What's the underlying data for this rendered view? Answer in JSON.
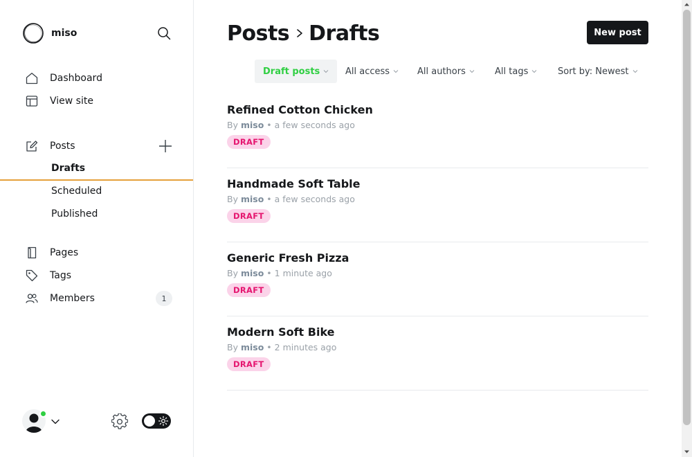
{
  "brand": {
    "name": "miso"
  },
  "sidebar": {
    "items": [
      {
        "label": "Dashboard",
        "icon": "home-icon"
      },
      {
        "label": "View site",
        "icon": "layout-icon"
      },
      {
        "label": "Posts",
        "icon": "edit-icon"
      },
      {
        "label": "Pages",
        "icon": "page-icon"
      },
      {
        "label": "Tags",
        "icon": "tag-icon"
      },
      {
        "label": "Members",
        "icon": "members-icon",
        "count": "1"
      }
    ],
    "post_subitems": [
      {
        "label": "Drafts",
        "active": true
      },
      {
        "label": "Scheduled"
      },
      {
        "label": "Published"
      }
    ],
    "accent_color": "#e5a03a"
  },
  "header": {
    "breadcrumb_parent": "Posts",
    "breadcrumb_current": "Drafts",
    "new_post_label": "New post"
  },
  "filters": [
    {
      "label": "Draft posts",
      "active": true
    },
    {
      "label": "All access"
    },
    {
      "label": "All authors"
    },
    {
      "label": "All tags"
    },
    {
      "label": "Sort by: Newest"
    }
  ],
  "posts": [
    {
      "title": "Refined Cotton Chicken",
      "by": "By",
      "author": "miso",
      "time": "• a few seconds ago",
      "status": "DRAFT"
    },
    {
      "title": "Handmade Soft Table",
      "by": "By",
      "author": "miso",
      "time": "• a few seconds ago",
      "status": "DRAFT"
    },
    {
      "title": "Generic Fresh Pizza",
      "by": "By",
      "author": "miso",
      "time": "• 1 minute ago",
      "status": "DRAFT"
    },
    {
      "title": "Modern Soft Bike",
      "by": "By",
      "author": "miso",
      "time": "• 2 minutes ago",
      "status": "DRAFT"
    }
  ],
  "colors": {
    "active_filter": "#30cf43",
    "draft_badge_bg": "#fbd3e9",
    "draft_badge_text": "#e5156f",
    "online": "#30cf43"
  }
}
